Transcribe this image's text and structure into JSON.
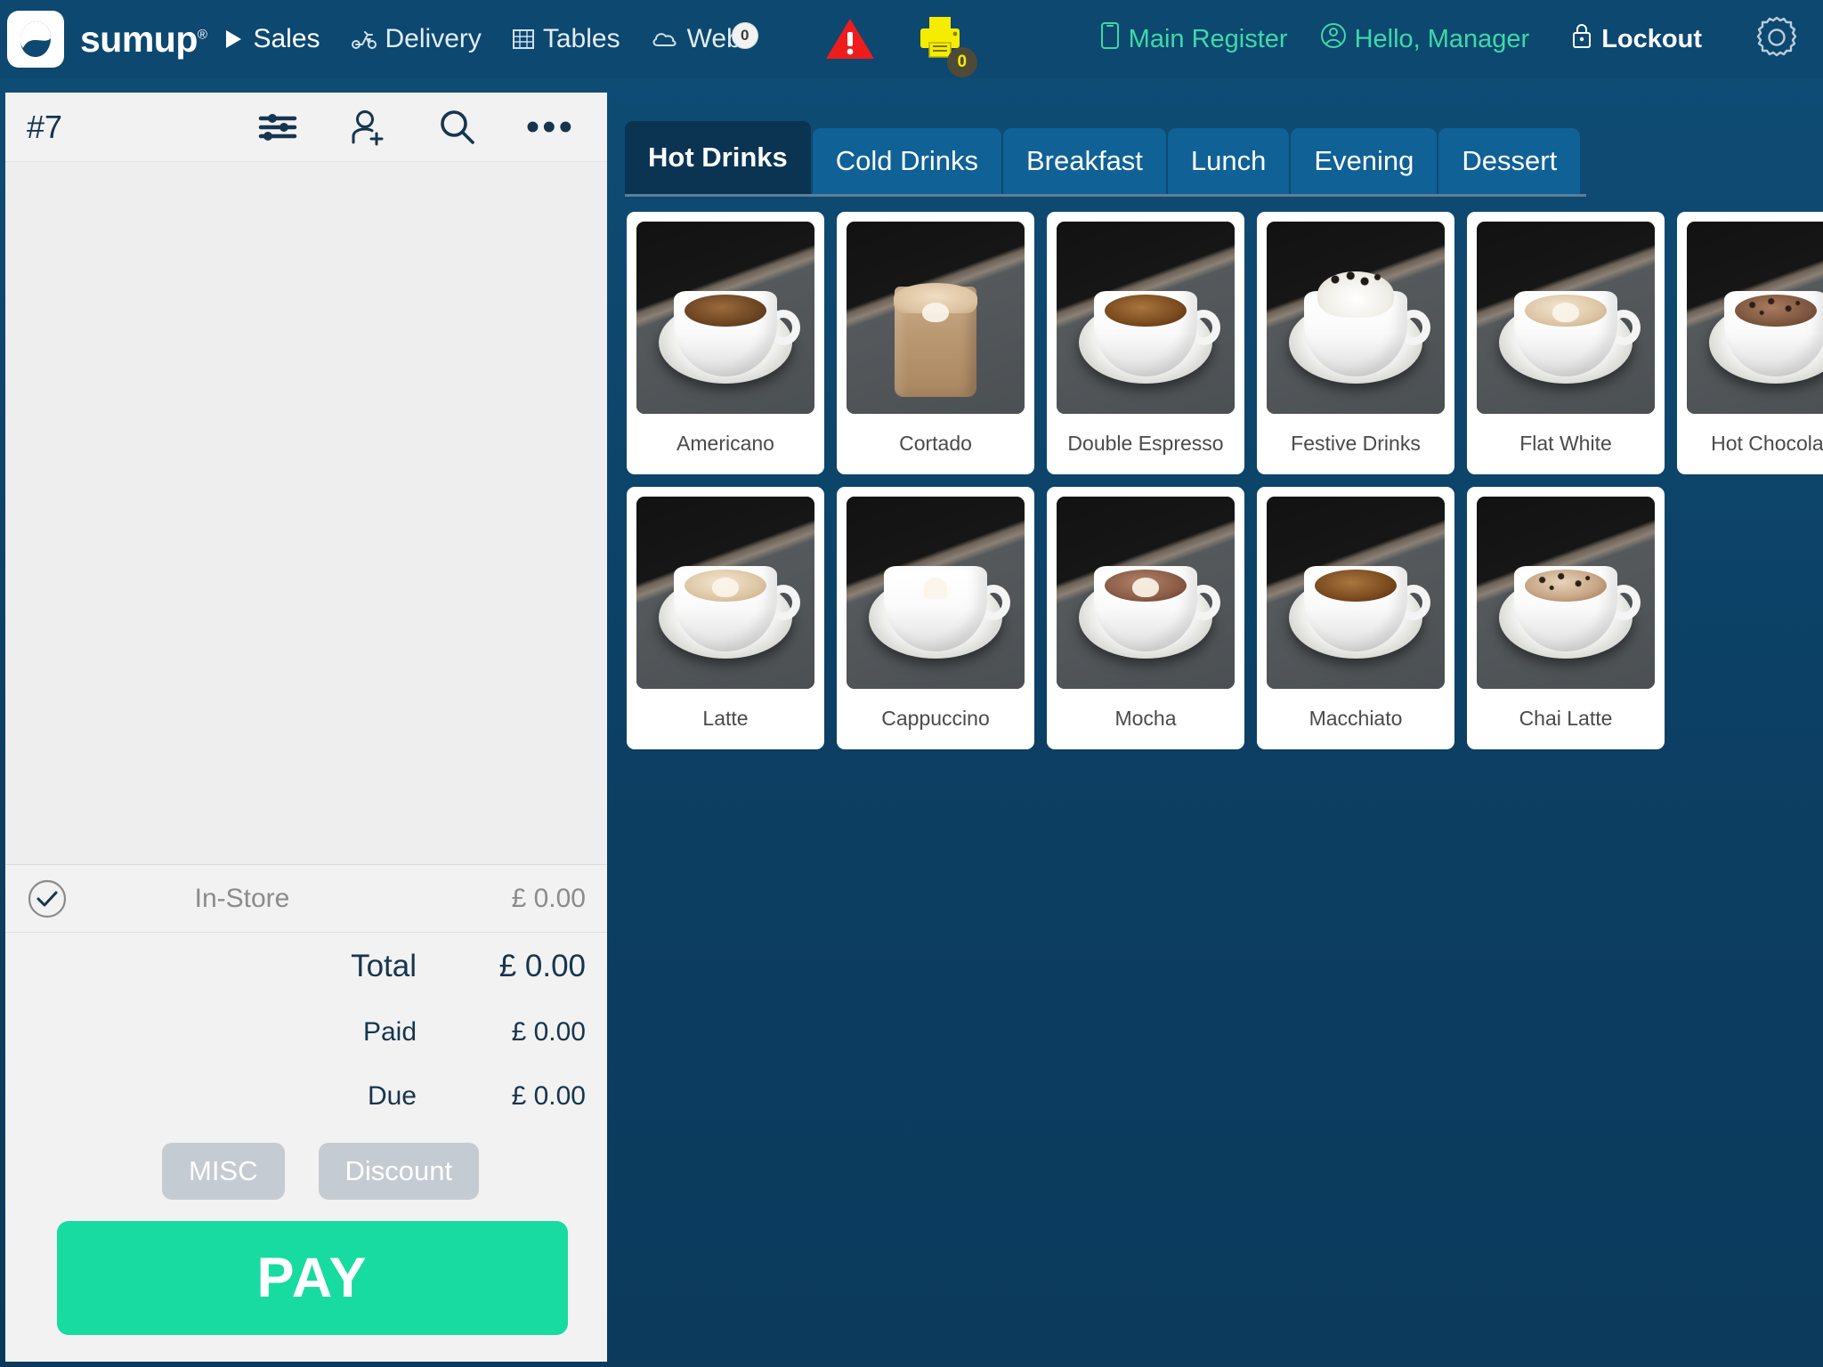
{
  "topbar": {
    "logo_text": "sumup",
    "logo_sup": "®",
    "nav": [
      {
        "label": "Sales",
        "icon": "play-icon",
        "active": true,
        "badge": null
      },
      {
        "label": "Delivery",
        "icon": "scooter-icon",
        "active": false,
        "badge": null
      },
      {
        "label": "Tables",
        "icon": "grid-icon",
        "active": false,
        "badge": null
      },
      {
        "label": "Web",
        "icon": "cloud-icon",
        "active": false,
        "badge": "0"
      }
    ],
    "alert_icon": "warning-triangle-icon",
    "printer_icon": "printer-icon",
    "printer_badge": "0",
    "register_label": "Main Register",
    "register_icon": "device-icon",
    "user_label": "Hello, Manager",
    "user_icon": "user-circle-icon",
    "lockout_label": "Lockout",
    "lockout_icon": "lock-icon",
    "settings_icon": "gear-icon",
    "accent_teal": "#3fd8a8",
    "bar_bg": "#0c4870"
  },
  "order": {
    "number": "#7",
    "icons": {
      "filter": "sliders-icon",
      "add_customer": "add-person-icon",
      "search": "search-icon",
      "more": "more-options-icon"
    },
    "tender": {
      "label": "In-Store",
      "amount": "£ 0.00",
      "check_icon": "check-circle-icon"
    },
    "totals": [
      {
        "label": "Total",
        "amount": "£ 0.00"
      },
      {
        "label": "Paid",
        "amount": "£ 0.00"
      },
      {
        "label": "Due",
        "amount": "£ 0.00"
      }
    ],
    "chips": [
      {
        "label": "MISC"
      },
      {
        "label": "Discount"
      }
    ],
    "pay_label": "PAY",
    "pay_color": "#17dba0"
  },
  "catalog": {
    "tabs": [
      {
        "label": "Hot Drinks",
        "active": true
      },
      {
        "label": "Cold Drinks",
        "active": false
      },
      {
        "label": "Breakfast",
        "active": false
      },
      {
        "label": "Lunch",
        "active": false
      },
      {
        "label": "Evening",
        "active": false
      },
      {
        "label": "Dessert",
        "active": false
      }
    ],
    "products": [
      {
        "label": "Americano",
        "style": "americano"
      },
      {
        "label": "Cortado",
        "style": "cortado"
      },
      {
        "label": "Double Espresso",
        "style": "espresso"
      },
      {
        "label": "Festive Drinks",
        "style": "festive"
      },
      {
        "label": "Flat White",
        "style": "flatwhite"
      },
      {
        "label": "Hot Chocolate",
        "style": "chocolate"
      },
      {
        "label": "Latte",
        "style": "latte"
      },
      {
        "label": "Cappuccino",
        "style": "cappuccino"
      },
      {
        "label": "Mocha",
        "style": "mocha"
      },
      {
        "label": "Macchiato",
        "style": "macchiato"
      },
      {
        "label": "Chai Latte",
        "style": "chai"
      }
    ]
  }
}
